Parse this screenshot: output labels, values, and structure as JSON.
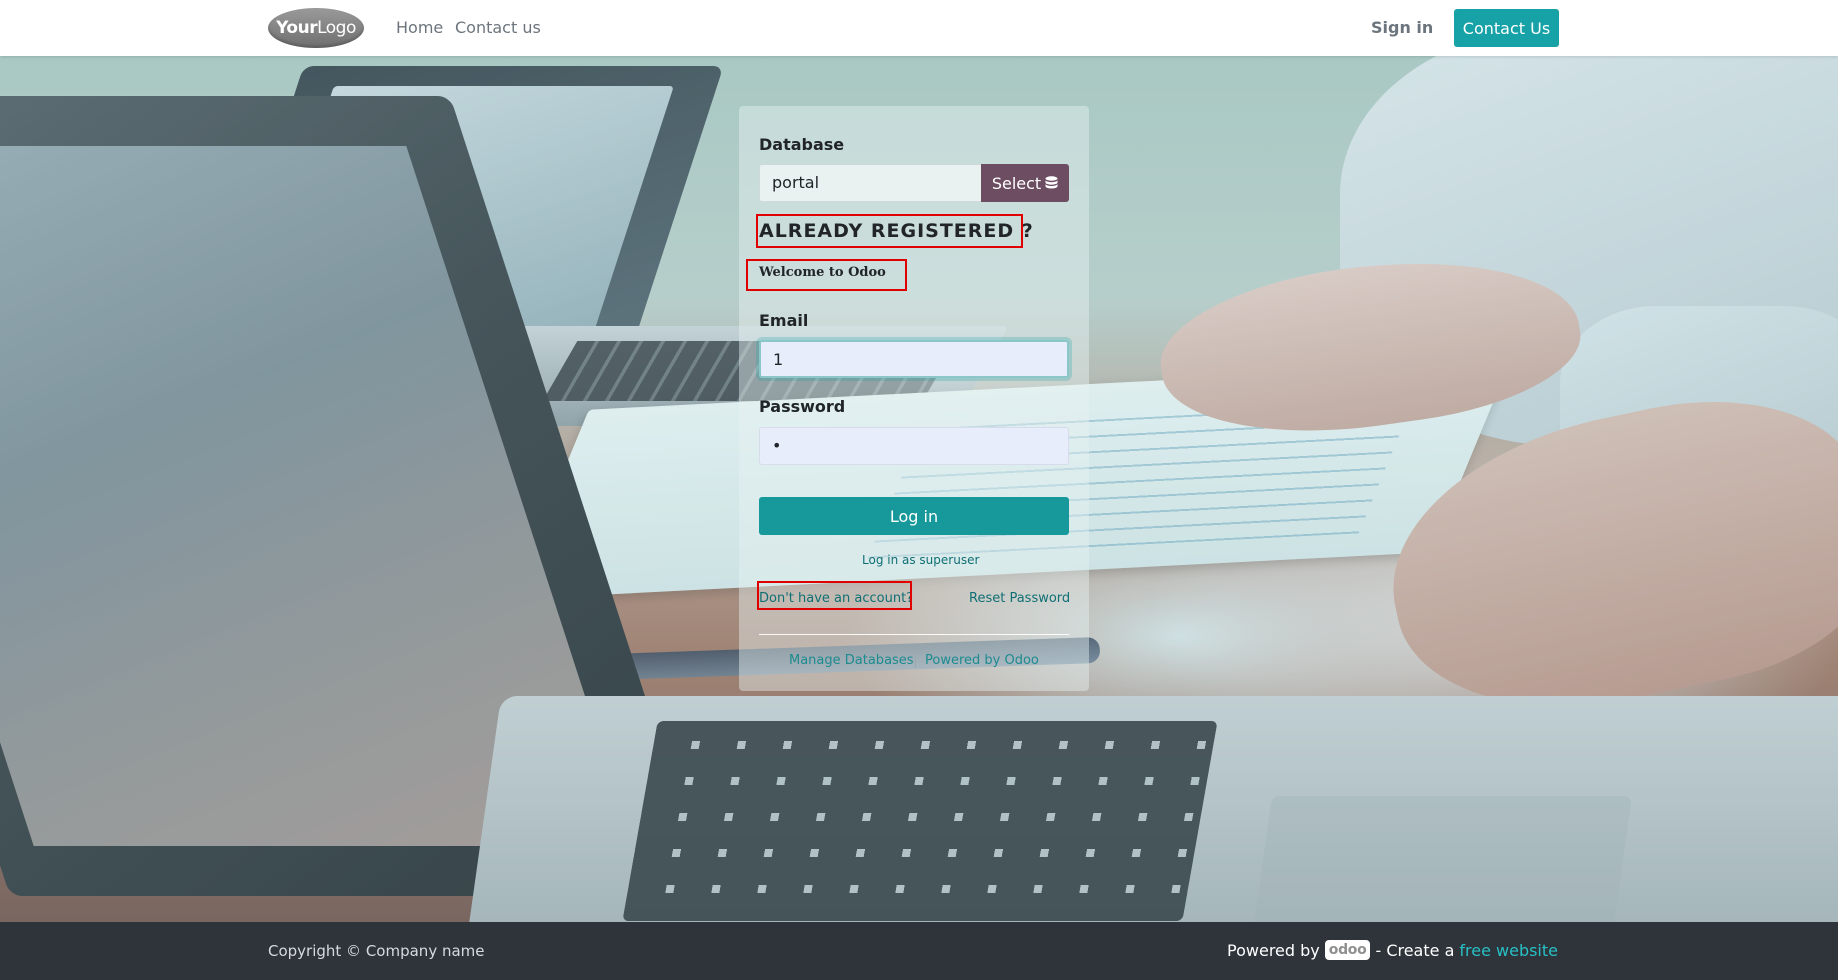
{
  "header": {
    "logo_bold": "Your",
    "logo_light": "Logo",
    "nav": [
      "Home",
      "Contact us"
    ],
    "sign_in": "Sign in",
    "contact_button": "Contact Us"
  },
  "login": {
    "database_label": "Database",
    "database_value": "portal",
    "select_button": "Select",
    "heading": "ALREADY REGISTERED ?",
    "welcome": "Welcome to Odoo",
    "email_label": "Email",
    "email_value": "1",
    "password_label": "Password",
    "password_value": "•",
    "login_button": "Log in",
    "superuser_link": "Log in as superuser",
    "signup_link": "Don't have an account?",
    "reset_link": "Reset Password",
    "manage_databases": "Manage Databases",
    "powered_by_odoo": "Powered by Odoo"
  },
  "footer": {
    "copyright": "Copyright © Company name",
    "powered_by": "Powered by",
    "odoo_badge": "odoo",
    "create_text": "- Create a",
    "free_website": "free website"
  },
  "colors": {
    "accent": "#17a2a8",
    "select_button": "#6d4d62",
    "footer_bg": "#2f343b",
    "highlight": "#e00000"
  }
}
